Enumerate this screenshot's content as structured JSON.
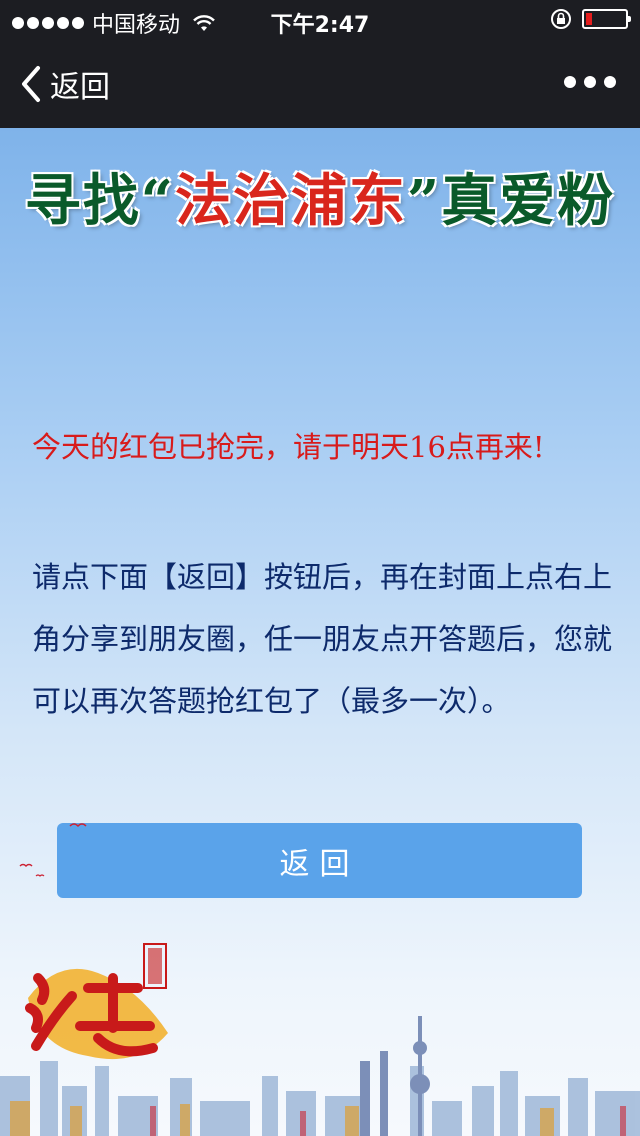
{
  "status_bar": {
    "carrier": "中国移动",
    "time": "下午2:47"
  },
  "nav": {
    "back_label": "返回"
  },
  "banner": {
    "title_prefix": "寻找“",
    "title_highlight": "法治浦东",
    "title_suffix": "”真爱粉"
  },
  "notice": {
    "message": "今天的红包已抢完，请于明天16点再来!"
  },
  "instructions": {
    "text": "请点下面【返回】按钮后，再在封面上点右上角分享到朋友圈，任一朋友点开答题后，您就可以再次答题抢红包了（最多一次）。"
  },
  "actions": {
    "return_label": "返回"
  },
  "colors": {
    "accent_button": "#5aa3ea",
    "notice_red": "#d81b1b",
    "instruction_blue": "#0d2a6b",
    "battery_low": "#e41e1e"
  },
  "status_values": {
    "battery_level": 0.15
  }
}
